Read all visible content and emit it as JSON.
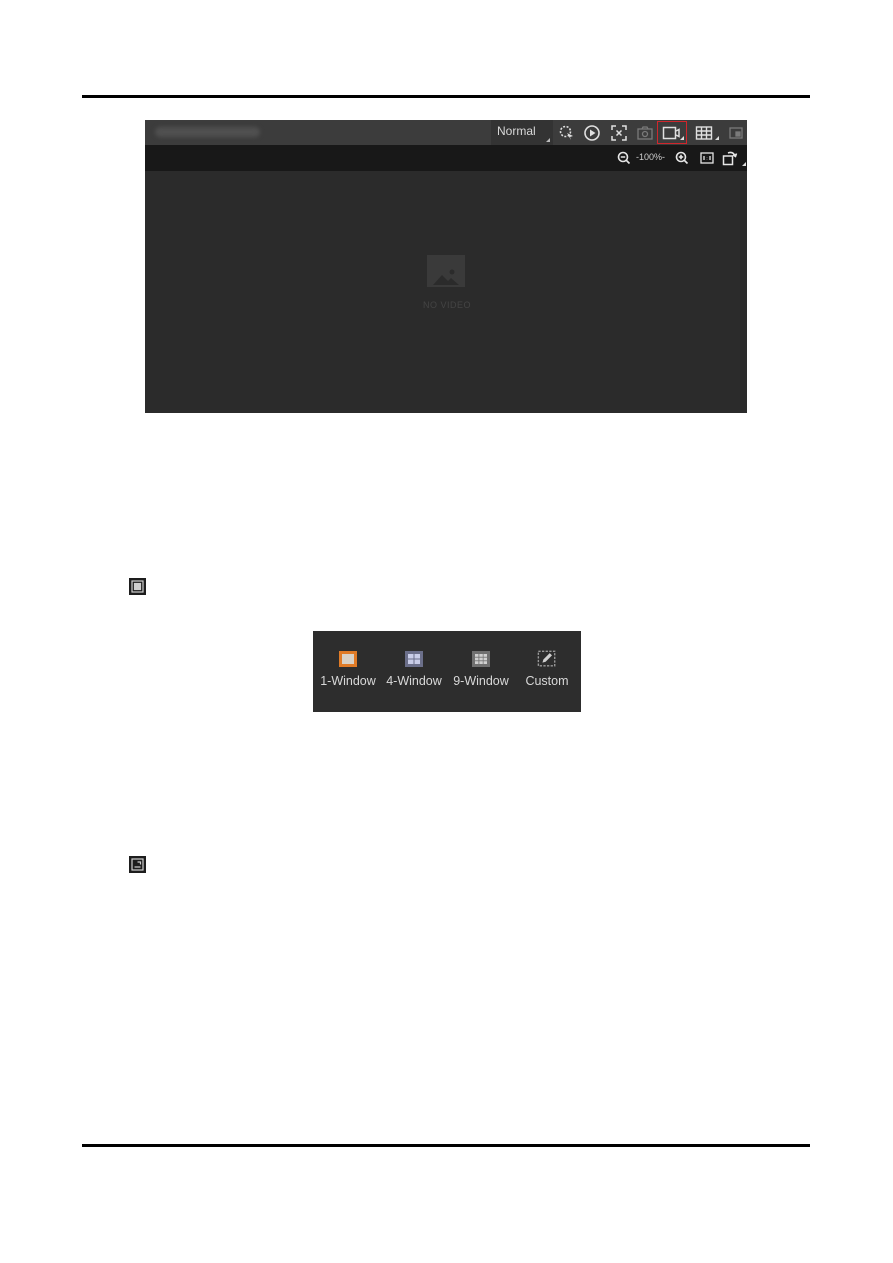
{
  "document": {
    "figure1": {
      "toolbar": {
        "title_blurred": "",
        "stream_mode": "Normal",
        "icons": [
          "smart-search-icon",
          "playback-icon",
          "fullscreen-icon",
          "snapshot-icon",
          "record-icon",
          "window-division-icon",
          "pip-icon"
        ],
        "highlighted_icon": "record-icon",
        "highlight_color": "#d0262c"
      },
      "subbar": {
        "zoom_level": "-100%-",
        "icons": [
          "zoom-out-icon",
          "zoom-in-icon",
          "original-size-icon",
          "rotate-icon"
        ]
      },
      "placeholder": {
        "icon": "image-icon",
        "text": "NO VIDEO"
      }
    },
    "figure2": {
      "items": [
        {
          "label": "1-Window",
          "icon": "one-window-icon",
          "selected": true,
          "color": "#e07b27"
        },
        {
          "label": "4-Window",
          "icon": "four-window-icon",
          "selected": false,
          "color": "#6b74b8"
        },
        {
          "label": "9-Window",
          "icon": "nine-window-icon",
          "selected": false,
          "color": "#9a9a9a"
        },
        {
          "label": "Custom",
          "icon": "custom-window-icon",
          "selected": false,
          "color": "#9a9a9a"
        }
      ]
    },
    "inline_icons": [
      "window-division-icon",
      "pip-icon"
    ]
  }
}
